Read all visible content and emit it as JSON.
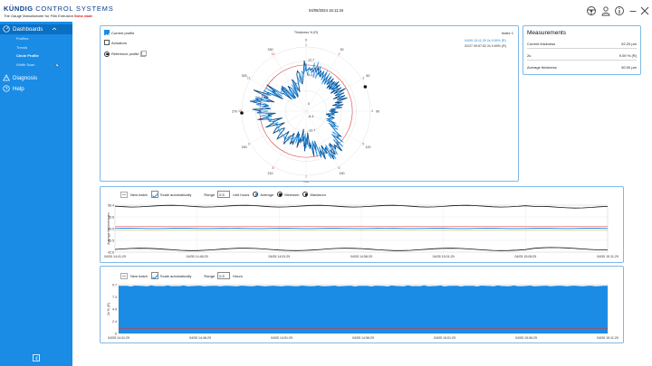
{
  "header": {
    "brand_name": "KÜNDIG",
    "brand_sub": "CONTROL SYSTEMS",
    "tagline": "The Gauge Manufacturer for Film Extrusion",
    "swiss": "Swiss made",
    "datetime": "04/05/2024 15:11:34"
  },
  "sidebar": {
    "dashboards": "Dashboards",
    "sub_items": [
      "Profiles",
      "Trends",
      "Circle Profile",
      "Width Scan"
    ],
    "diagnosis": "Diagnosis",
    "help": "Help"
  },
  "polar": {
    "title": "Thickness % (R)",
    "current_profile": "Current profile",
    "actuators": "Actuators",
    "reference_profile": "Reference profile",
    "index": "Index 1",
    "legend_line1": "04/05 15:11:29  2s 9.59% (R)",
    "legend_line2": "02/27 09:57:52  2s 9.69% (R)",
    "ring_labels": [
      "12.7",
      "6.4",
      "0",
      "-6.4",
      "-12.7"
    ],
    "angle_labels": [
      "0",
      "30",
      "60",
      "90",
      "120",
      "150",
      "180",
      "210",
      "240",
      "270",
      "300",
      "330"
    ],
    "red_marks": [
      "1",
      "2",
      "3",
      "4",
      "5",
      "6",
      "7",
      "8",
      "9",
      "10",
      "11",
      "12"
    ]
  },
  "measurements": {
    "title": "Measurements",
    "rows": [
      {
        "label": "Current thickness",
        "value": "52.20 µm"
      },
      {
        "label": "2s",
        "value": "9.59 % (R)"
      },
      {
        "label": "Average thickness",
        "value": "50.00 µm"
      }
    ]
  },
  "trend": {
    "new_batch": "New batch",
    "scale_auto": "Scale automatically",
    "range_label": "Range",
    "range_value": "0.5",
    "unit_label": "Unit hours",
    "avg_label": "Average",
    "min_label": "Minimum",
    "max_label": "Maximum",
    "ylabel": "Average thickness µm",
    "yticks": [
      "56.4",
      "53.6",
      "49.5",
      "45.5",
      "42.6"
    ],
    "xticks": [
      "04/05 14:41:29",
      "04/05 14:46:29",
      "04/05 14:51:29",
      "04/05 14:56:29",
      "04/05 15:01:29",
      "04/05 15:06:29",
      "04/05 15:11:29"
    ]
  },
  "twos": {
    "new_batch": "New batch",
    "scale_auto": "Scale automatically",
    "range_label": "Range",
    "range_value": "0.5",
    "unit_label": "Hours",
    "ylabel": "2s % (R)",
    "yticks": [
      "9.7",
      "7.3",
      "4.9",
      "2.4",
      "0"
    ],
    "xticks": [
      "04/05 14:41:29",
      "04/05 14:46:29",
      "04/05 14:51:29",
      "04/05 14:56:29",
      "04/05 15:01:29",
      "04/05 15:06:29",
      "04/05 15:11:29"
    ]
  },
  "colors": {
    "sidebar": "#1a8ce6",
    "accent": "#1a8ce6",
    "profile_line": "#0b4d8a",
    "reference_circle": "#d43b3b"
  }
}
